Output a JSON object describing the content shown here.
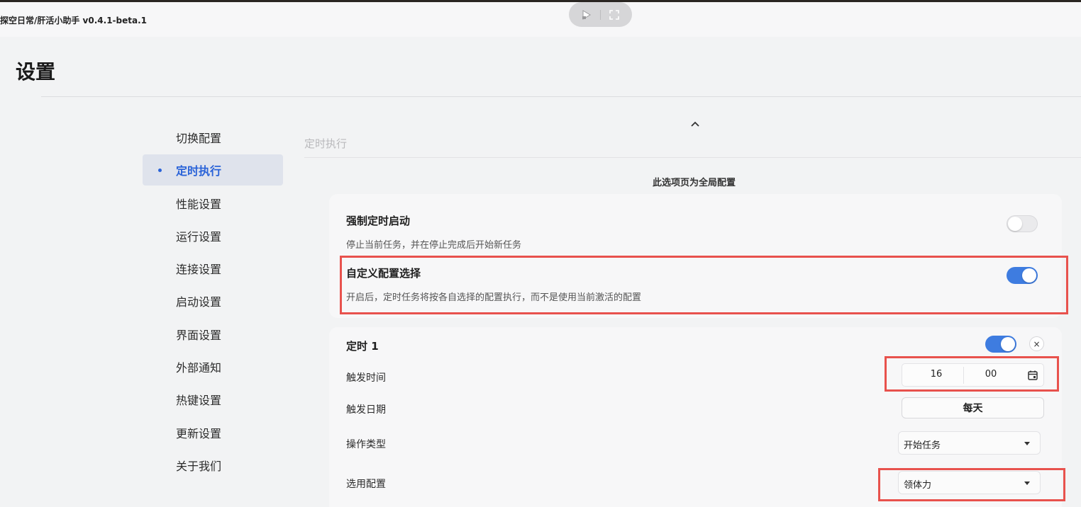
{
  "window": {
    "title": "探空日常/肝活小助手 v0.4.1-beta.1"
  },
  "page": {
    "title": "设置"
  },
  "sidebar": {
    "items": [
      {
        "label": "切换配置",
        "active": false
      },
      {
        "label": "定时执行",
        "active": true
      },
      {
        "label": "性能设置",
        "active": false
      },
      {
        "label": "运行设置",
        "active": false
      },
      {
        "label": "连接设置",
        "active": false
      },
      {
        "label": "启动设置",
        "active": false
      },
      {
        "label": "界面设置",
        "active": false
      },
      {
        "label": "外部通知",
        "active": false
      },
      {
        "label": "热键设置",
        "active": false
      },
      {
        "label": "更新设置",
        "active": false
      },
      {
        "label": "关于我们",
        "active": false
      }
    ]
  },
  "section": {
    "title": "定时执行",
    "note": "此选项页为全局配置"
  },
  "force_start": {
    "label": "强制定时启动",
    "desc": "停止当前任务，并在停止完成后开始新任务",
    "enabled": false
  },
  "custom_config": {
    "label": "自定义配置选择",
    "desc": "开启后，定时任务将按各自选择的配置执行，而不是使用当前激活的配置",
    "enabled": true
  },
  "timer": {
    "label": "定时 1",
    "enabled": true,
    "close_label": "×",
    "trigger_time": {
      "label": "触发时间",
      "hour": "16",
      "minute": "00"
    },
    "trigger_date": {
      "label": "触发日期",
      "value": "每天"
    },
    "action_type": {
      "label": "操作类型",
      "value": "开始任务"
    },
    "config_select": {
      "label": "选用配置",
      "value": "领体力"
    }
  },
  "colors": {
    "accent": "#3e7ce0",
    "active_text": "#2a63d8",
    "highlight": "#e8524d"
  }
}
